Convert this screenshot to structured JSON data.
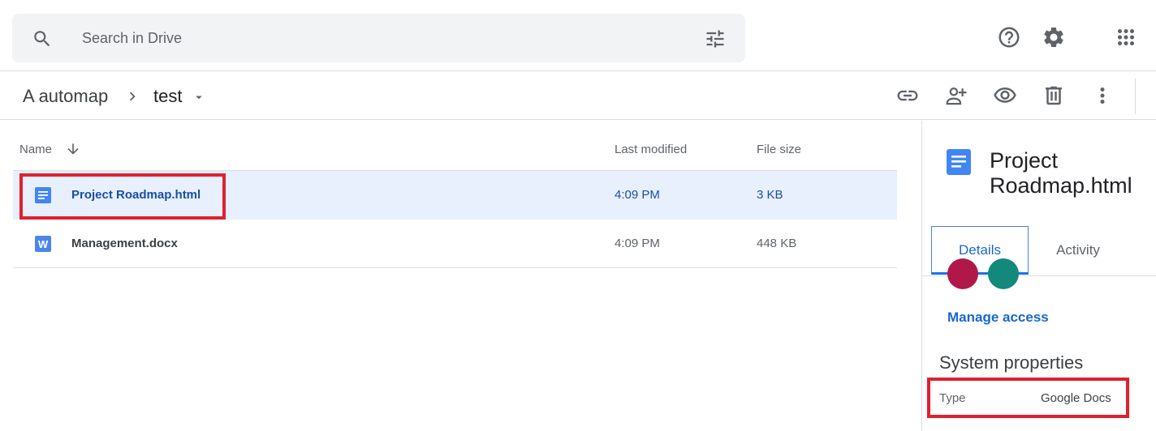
{
  "search": {
    "placeholder": "Search in Drive"
  },
  "header_icons": [
    "help-icon",
    "settings-icon",
    "apps-icon"
  ],
  "breadcrumb": {
    "root": "A automap",
    "current": "test"
  },
  "toolbar_icons": [
    "link-icon",
    "share-icon",
    "preview-icon",
    "delete-icon",
    "more-icon"
  ],
  "list": {
    "columns": {
      "name": "Name",
      "modified": "Last modified",
      "size": "File size"
    },
    "rows": [
      {
        "name": "Project Roadmap.html",
        "modified": "4:09 PM",
        "size": "3 KB",
        "icon": "docs-icon",
        "selected": true
      },
      {
        "name": "Management.docx",
        "modified": "4:09 PM",
        "size": "448 KB",
        "icon": "word-icon",
        "selected": false
      }
    ]
  },
  "details": {
    "title": "Project Roadmap.html",
    "tabs": {
      "details": "Details",
      "activity": "Activity"
    },
    "manage_access": "Manage access",
    "system_properties": "System properties",
    "type_label": "Type",
    "type_value": "Google Docs"
  },
  "colors": {
    "accent": "#1a73e8",
    "highlight": "#e0202e",
    "selected_row": "#e8f0fe"
  }
}
